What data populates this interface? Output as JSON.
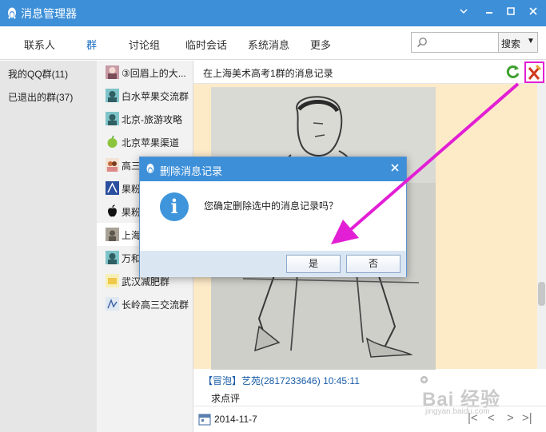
{
  "window": {
    "title": "消息管理器",
    "icons": {
      "app": "qq-penguin-icon",
      "minimize": "minimize-icon",
      "maximize": "maximize-icon",
      "close": "close-icon"
    }
  },
  "tabs": [
    {
      "label": "联系人"
    },
    {
      "label": "群",
      "active": true
    },
    {
      "label": "讨论组"
    },
    {
      "label": "临时会话"
    },
    {
      "label": "系统消息"
    },
    {
      "label": "更多"
    }
  ],
  "search": {
    "value": "",
    "placeholder": "",
    "button_label": "搜索",
    "icon": "search-icon"
  },
  "left_nav": [
    {
      "label": "我的QQ群(11)"
    },
    {
      "label": "已退出的群(37)"
    }
  ],
  "groups": [
    {
      "label": "③回眉上的大...",
      "icon": "group-avatar-icon"
    },
    {
      "label": "白水苹果交流群",
      "icon": "group-avatar-icon"
    },
    {
      "label": "北京-旅游攻略",
      "icon": "group-avatar-icon"
    },
    {
      "label": "北京苹果渠道",
      "icon": "apple-fruit-icon"
    },
    {
      "label": "高三",
      "icon": "group-avatar-icon"
    },
    {
      "label": "果粉",
      "icon": "group-avatar-icon"
    },
    {
      "label": "果粉",
      "icon": "apple-logo-icon"
    },
    {
      "label": "上海",
      "icon": "group-avatar-icon",
      "selected": true
    },
    {
      "label": "万和",
      "icon": "group-avatar-icon"
    },
    {
      "label": "武汉减肥群",
      "icon": "group-avatar-icon"
    },
    {
      "label": "长岭高三交流群",
      "icon": "group-avatar-icon"
    }
  ],
  "chat": {
    "title": "在上海美术高考1群的消息记录",
    "message_sender": "【冒泡】艺苑(2817233646) 10:45:11",
    "message_text": "求点评",
    "date": "2014-11-7",
    "icons": {
      "refresh": "refresh-icon",
      "delete": "delete-record-icon",
      "zoom": "zoom-in-icon",
      "calendar": "calendar-icon"
    },
    "nav": {
      "first": "|<",
      "prev": "<",
      "next": ">",
      "last": ">|"
    }
  },
  "dialog": {
    "title": "删除消息记录",
    "message": "您确定删除选中的消息记录吗？",
    "yes_label": "是",
    "no_label": "否",
    "icon": "info-icon"
  },
  "watermark": {
    "text": "Bai 经验",
    "url": "jingyan.baidu.com"
  },
  "colors": {
    "title_bar": "#3d8fd8",
    "highlight": "#e21fd4",
    "image_bg": "#fdebc8",
    "link": "#1a5ca8"
  }
}
